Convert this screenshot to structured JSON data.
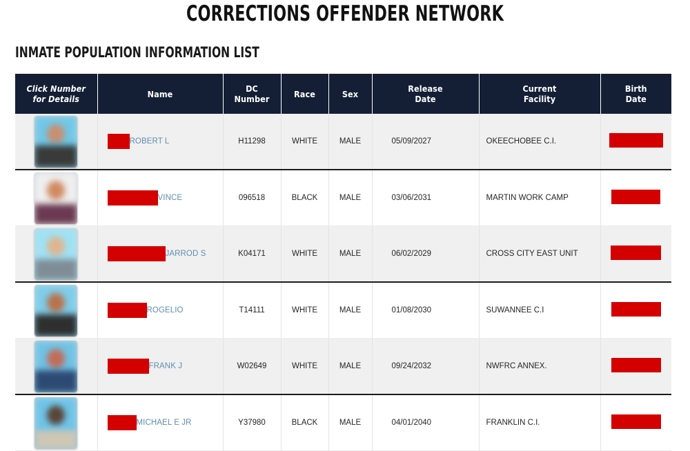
{
  "page": {
    "title": "CORRECTIONS OFFENDER NETWORK",
    "subtitle": "INMATE POPULATION INFORMATION LIST"
  },
  "colors": {
    "header_bg": "#141f35",
    "redaction": "#d40000",
    "link": "#5e8cb0",
    "row_shade": "#f0f0f0"
  },
  "table": {
    "columns": [
      {
        "id": "photo",
        "label_line1": "Click Number",
        "label_line2": "for Details"
      },
      {
        "id": "name",
        "label_line1": "Name",
        "label_line2": ""
      },
      {
        "id": "dc",
        "label_line1": "DC",
        "label_line2": "Number"
      },
      {
        "id": "race",
        "label_line1": "Race",
        "label_line2": ""
      },
      {
        "id": "sex",
        "label_line1": "Sex",
        "label_line2": ""
      },
      {
        "id": "release",
        "label_line1": "Release",
        "label_line2": "Date"
      },
      {
        "id": "facility",
        "label_line1": "Current",
        "label_line2": "Facility"
      },
      {
        "id": "birth",
        "label_line1": "Birth",
        "label_line2": "Date"
      }
    ],
    "rows": [
      {
        "photo_alt": "inmate-photo-blurred",
        "name_redacted_width": 32,
        "name_visible": "ROBERT L",
        "dc_number": "H11298",
        "race": "WHITE",
        "sex": "MALE",
        "release_date": "05/09/2027",
        "facility": "OKEECHOBEE C.I.",
        "birth_date_redacted_width": 78
      },
      {
        "photo_alt": "inmate-photo-blurred",
        "name_redacted_width": 73,
        "name_visible": "VINCE",
        "dc_number": "096518",
        "race": "BLACK",
        "sex": "MALE",
        "release_date": "03/06/2031",
        "facility": "MARTIN WORK CAMP",
        "birth_date_redacted_width": 71
      },
      {
        "photo_alt": "inmate-photo-blurred",
        "name_redacted_width": 84,
        "name_visible": "JARROD S",
        "dc_number": "K04171",
        "race": "WHITE",
        "sex": "MALE",
        "release_date": "06/02/2029",
        "facility": "CROSS CITY EAST UNIT",
        "birth_date_redacted_width": 73
      },
      {
        "photo_alt": "inmate-photo-blurred",
        "name_redacted_width": 57,
        "name_visible": "ROGELIO",
        "dc_number": "T14111",
        "race": "WHITE",
        "sex": "MALE",
        "release_date": "01/08/2030",
        "facility": "SUWANNEE C.I",
        "birth_date_redacted_width": 72
      },
      {
        "photo_alt": "inmate-photo-blurred",
        "name_redacted_width": 60,
        "name_visible": "FRANK J",
        "dc_number": "W02649",
        "race": "WHITE",
        "sex": "MALE",
        "release_date": "09/24/2032",
        "facility": "NWFRC ANNEX.",
        "birth_date_redacted_width": 72
      },
      {
        "photo_alt": "inmate-photo-blurred",
        "name_redacted_width": 42,
        "name_visible": "MICHAEL E JR",
        "dc_number": "Y37980",
        "race": "BLACK",
        "sex": "MALE",
        "release_date": "04/01/2040",
        "facility": "FRANKLIN C.I.",
        "birth_date_redacted_width": 72
      }
    ]
  }
}
